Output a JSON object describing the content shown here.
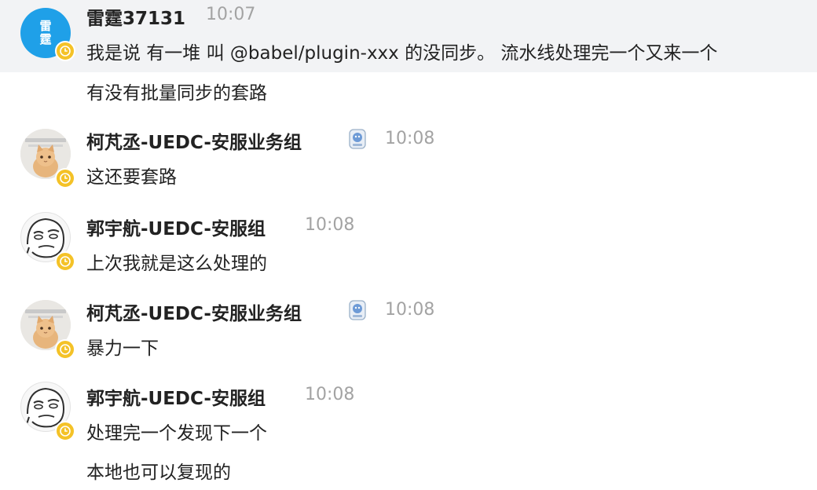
{
  "messages": [
    {
      "author": "雷霆37131",
      "time": "10:07",
      "lines": [
        "我是说 有一堆 叫 @babel/plugin-xxx 的没同步。 流水线处理完一个又来一个",
        "有没有批量同步的套路"
      ],
      "avatar_text": "雷\n霆",
      "avatar_color": "#1fa0e8"
    },
    {
      "author": "柯芃丞-UEDC-安服业务组",
      "time": "10:08",
      "lines": [
        "这还要套路"
      ]
    },
    {
      "author": "郭宇航-UEDC-安服组",
      "time": "10:08",
      "lines": [
        "上次我就是这么处理的"
      ]
    },
    {
      "author": "柯芃丞-UEDC-安服业务组",
      "time": "10:08",
      "lines": [
        "暴力一下"
      ]
    },
    {
      "author": "郭宇航-UEDC-安服组",
      "time": "10:08",
      "lines": [
        "处理完一个发现下一个",
        "本地也可以复现的"
      ]
    }
  ],
  "colors": {
    "highlight": "#f2f3f5",
    "status": "#f4c227",
    "time": "#a3a3a3"
  },
  "icons": {
    "status": "clock-icon",
    "badge": "emoji-badge-icon"
  }
}
